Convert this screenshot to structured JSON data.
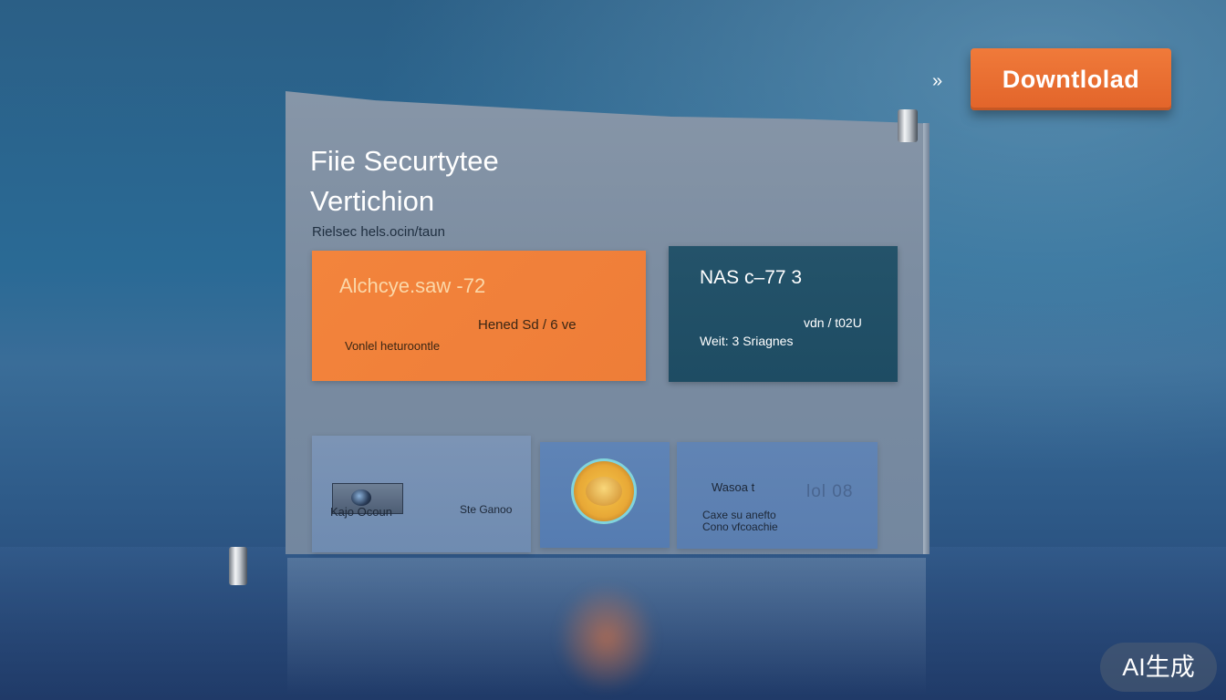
{
  "header": {
    "download_label": "Downtlolad",
    "arrow_icon": "double-chevron-right-icon"
  },
  "panel": {
    "title": "Fiie Securtytee Vertichion",
    "subtitle": "Rielsec hels.ocin/taun"
  },
  "card_orange": {
    "line1": "Alchcye.saw -72",
    "line2": "Hened Sd / 6 ve",
    "line3": "Vonlel heturoontle"
  },
  "card_teal": {
    "line1": "NAS c–77 3",
    "line2": "vdn / t02U",
    "line3": "Weit: 3 Sriagnes"
  },
  "tiles": {
    "tile1_label_a": "Kajo Ocoun",
    "tile1_label_b": "Ste Ganoo",
    "tile2_icon": "seal-badge-icon",
    "tile3_label_a": "Wasoa t",
    "tile3_label_b": "lol 08",
    "tile3_label_c": "Caxe su anefto Cono vfcoachie"
  },
  "watermark": "AI生成",
  "colors": {
    "accent_orange": "#ee7d38",
    "card_teal": "#1e4c63",
    "background": "#2a6a95"
  }
}
